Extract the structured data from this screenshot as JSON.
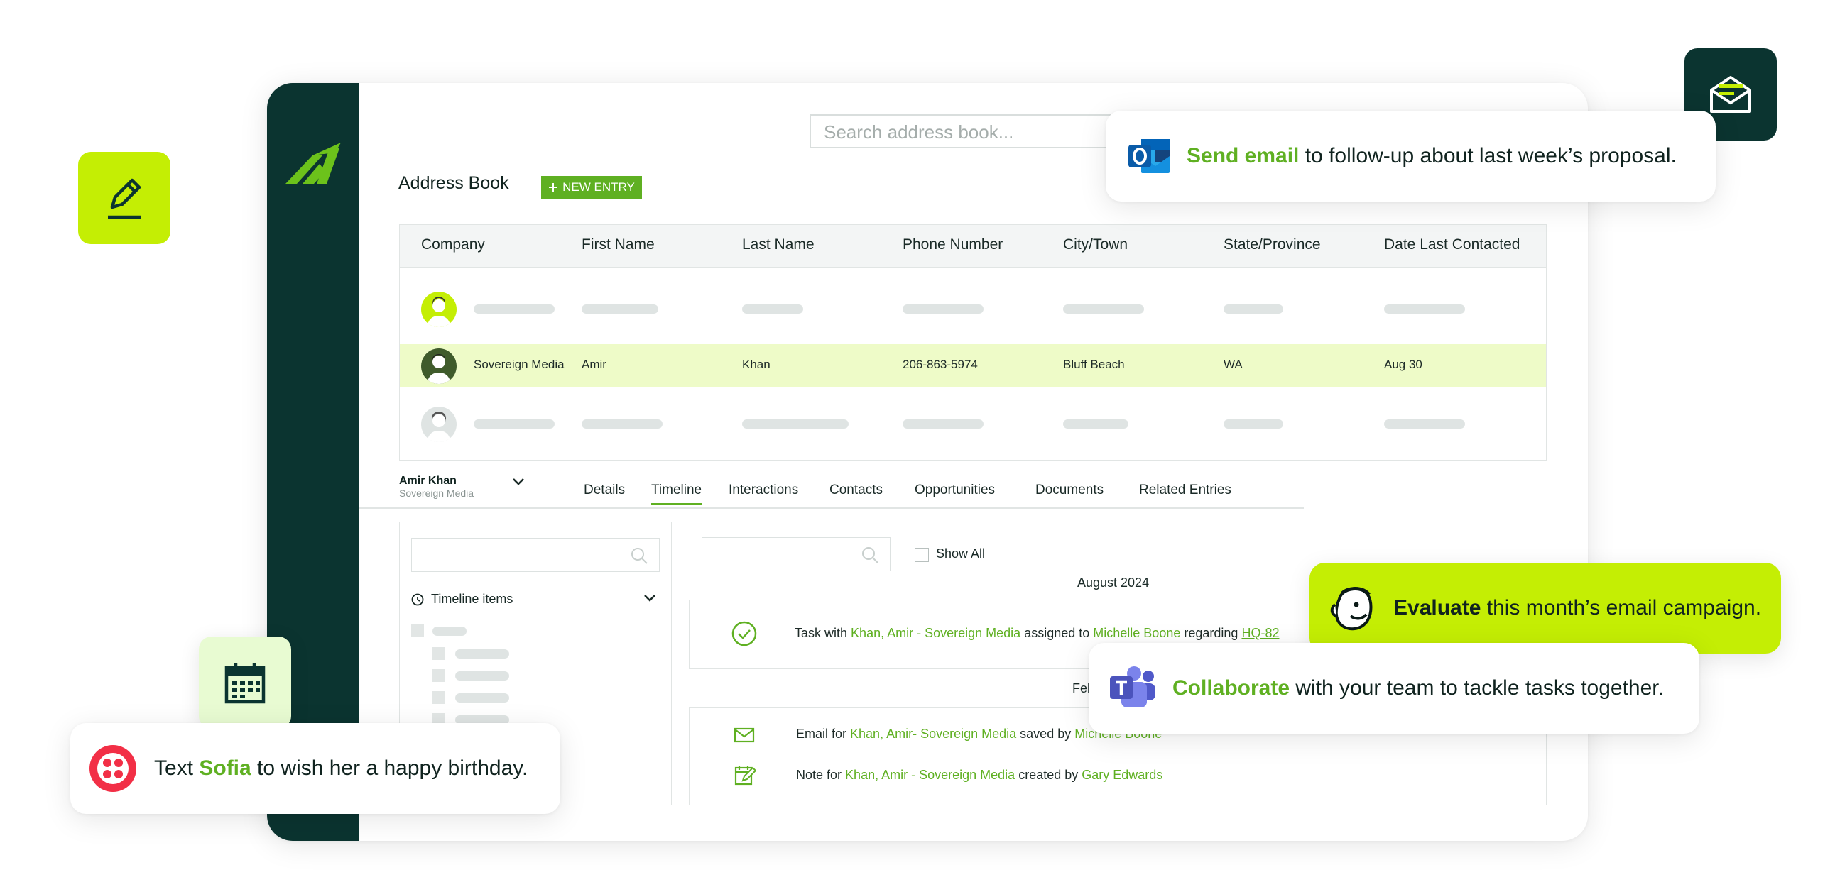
{
  "search": {
    "placeholder": "Search address book..."
  },
  "address_book": {
    "title": "Address Book",
    "new_entry_label": "NEW ENTRY",
    "columns": [
      "Company",
      "First Name",
      "Last Name",
      "Phone Number",
      "City/Town",
      "State/Province",
      "Date Last Contacted"
    ],
    "selected_row": {
      "company": "Sovereign Media",
      "first_name": "Amir",
      "last_name": "Khan",
      "phone": "206-863-5974",
      "city": "Bluff Beach",
      "state": "WA",
      "date_last_contacted": "Aug 30"
    }
  },
  "profile": {
    "name": "Amir Khan",
    "company": "Sovereign Media"
  },
  "tabs": [
    "Details",
    "Timeline",
    "Interactions",
    "Contacts",
    "Opportunities",
    "Documents",
    "Related Entries"
  ],
  "active_tab": "Timeline",
  "left_panel": {
    "timeline_items_label": "Timeline items"
  },
  "timeline": {
    "show_all_label": "Show All",
    "month_august": "August 2024",
    "month_feb_partial": "Feb",
    "task": {
      "prefix": "Task with",
      "contact": "Khan, Amir - Sovereign Media",
      "assigned": "assigned to",
      "assignee": "Michelle Boone",
      "regarding": "regarding",
      "ref": "HQ-82"
    },
    "email": {
      "prefix": "Email for",
      "contact": "Khan, Amir- Sovereign Media",
      "saved": "saved by",
      "by": "Michelle Boone"
    },
    "note": {
      "prefix": "Note for",
      "contact": "Khan, Amir - Sovereign Media",
      "created": "created by",
      "by": "Gary Edwards"
    }
  },
  "bubbles": {
    "email": {
      "bold": "Send email",
      "rest": " to follow-up about last week’s proposal."
    },
    "evaluate": {
      "bold": "Evaluate",
      "rest": " this month’s email campaign."
    },
    "collaborate": {
      "bold": "Collaborate",
      "rest": " with your team to tackle tasks together."
    },
    "text": {
      "pre": "Text ",
      "bold": "Sofia",
      "rest": " to wish her a happy birthday."
    }
  },
  "colors": {
    "sidebar": "#0b3430",
    "accent_green": "#5fb022",
    "lime": "#c4ee04",
    "selected_row": "#eefbc8",
    "twilio_red": "#f22f46",
    "teams_purple": "#5059c9"
  },
  "icons": [
    "logo-icon",
    "pencil-icon",
    "calendar-icon",
    "mail-icon",
    "outlook-icon",
    "mailchimp-icon",
    "teams-icon",
    "twilio-icon",
    "check-circle-icon",
    "note-icon",
    "search-icon",
    "clock-icon",
    "chevron-down-icon",
    "plus-icon"
  ]
}
